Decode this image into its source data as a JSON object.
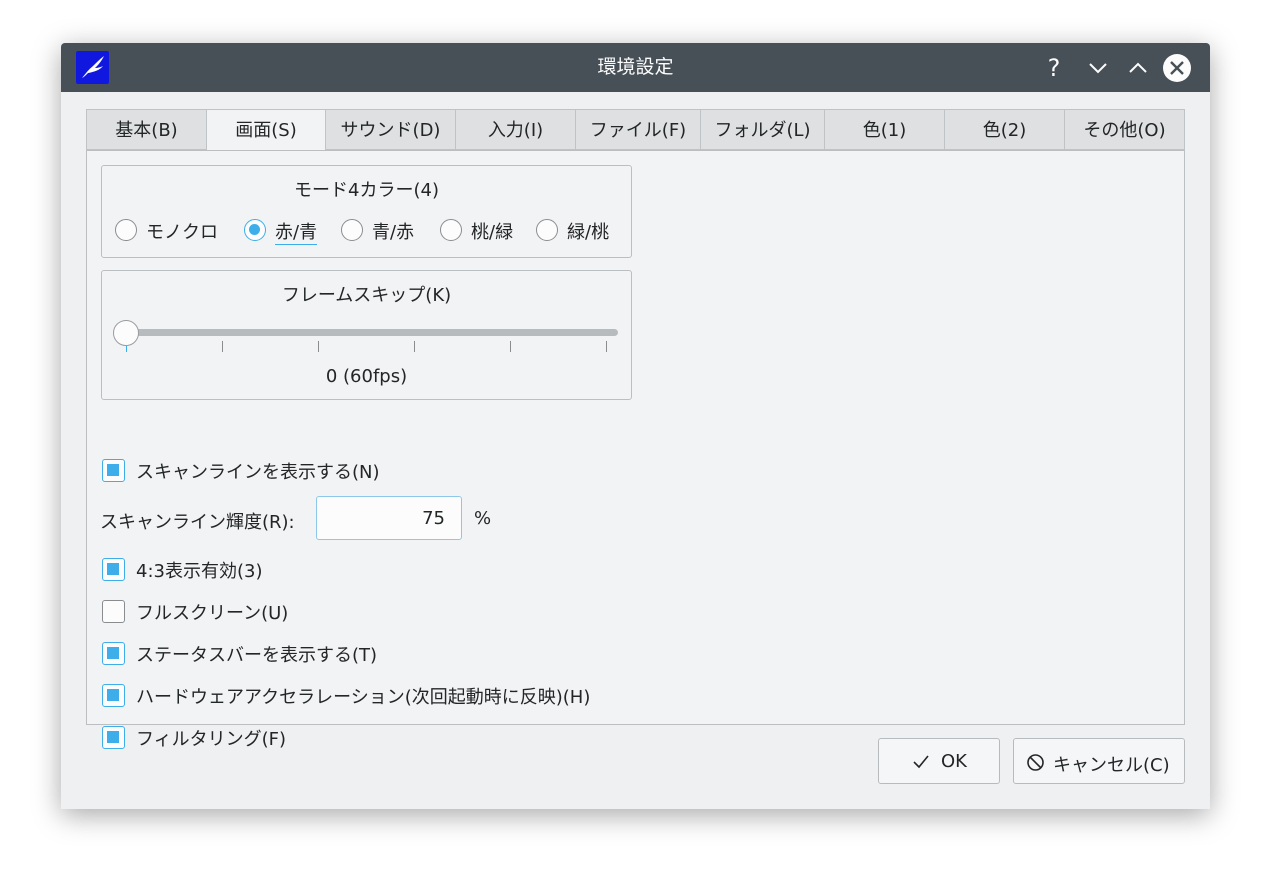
{
  "window": {
    "title": "環境設定",
    "help_glyph": "?",
    "accent_color": "#3daee9",
    "titlebar_color": "#475057"
  },
  "tabs": [
    {
      "label": "基本(B)",
      "active": false
    },
    {
      "label": "画面(S)",
      "active": true
    },
    {
      "label": "サウンド(D)",
      "active": false
    },
    {
      "label": "入力(I)",
      "active": false
    },
    {
      "label": "ファイル(F)",
      "active": false
    },
    {
      "label": "フォルダ(L)",
      "active": false
    },
    {
      "label": "色(1)",
      "active": false
    },
    {
      "label": "色(2)",
      "active": false
    },
    {
      "label": "その他(O)",
      "active": false
    }
  ],
  "mode_group": {
    "title": "モード4カラー(4)",
    "options": [
      {
        "label": "モノクロ",
        "selected": false
      },
      {
        "label": "赤/青",
        "selected": true
      },
      {
        "label": "青/赤",
        "selected": false
      },
      {
        "label": "桃/緑",
        "selected": false
      },
      {
        "label": "緑/桃",
        "selected": false
      }
    ]
  },
  "frameskip_group": {
    "title": "フレームスキップ(K)",
    "value_text": "0 (60fps)",
    "slider_value": 0,
    "slider_max": 5
  },
  "options": {
    "scanline": {
      "label": "スキャンラインを表示する(N)",
      "checked": true
    },
    "scanline_brightness": {
      "label": "スキャンライン輝度(R):",
      "value": "75",
      "unit": "%"
    },
    "aspect43": {
      "label": "4:3表示有効(3)",
      "checked": true
    },
    "fullscreen": {
      "label": "フルスクリーン(U)",
      "checked": false
    },
    "statusbar": {
      "label": "ステータスバーを表示する(T)",
      "checked": true
    },
    "hwaccel": {
      "label": "ハードウェアアクセラレーション(次回起動時に反映)(H)",
      "checked": true
    },
    "filtering": {
      "label": "フィルタリング(F)",
      "checked": true
    }
  },
  "buttons": {
    "ok_label": "OK",
    "cancel_label": "キャンセル(C)"
  }
}
